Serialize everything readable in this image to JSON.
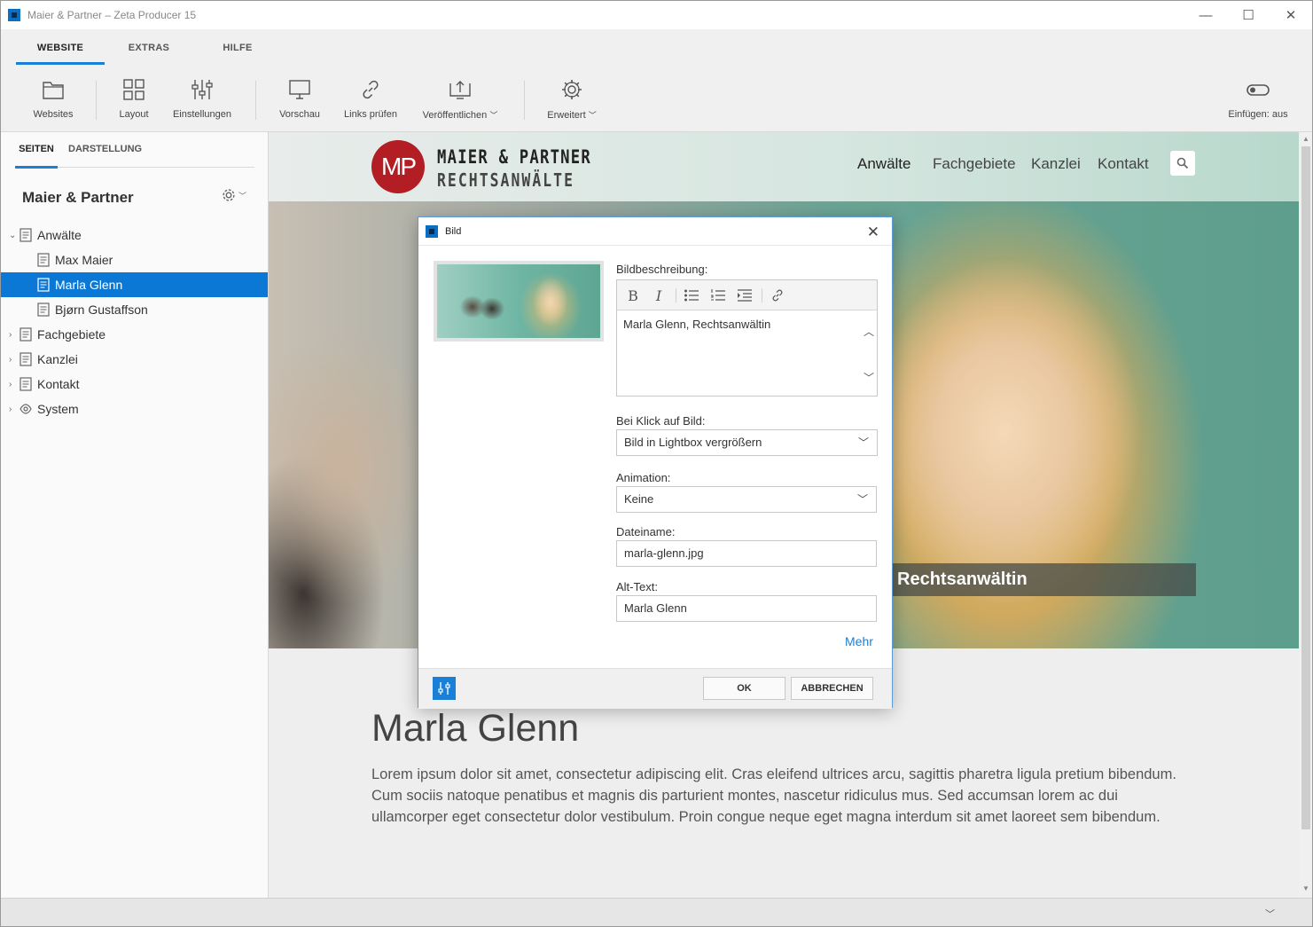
{
  "window": {
    "title": "Maier & Partner – Zeta Producer 15",
    "minimize": "—",
    "maximize": "☐",
    "close": "✕"
  },
  "ribbon": {
    "tabs": [
      "WEBSITE",
      "EXTRAS",
      "HILFE"
    ],
    "active_tab": "WEBSITE",
    "buttons": {
      "websites": "Websites",
      "layout": "Layout",
      "settings": "Einstellungen",
      "preview": "Vorschau",
      "check_links": "Links prüfen",
      "publish": "Veröffentlichen",
      "advanced": "Erweitert",
      "insert": "Einfügen: aus"
    }
  },
  "sidebar": {
    "tabs": [
      "SEITEN",
      "DARSTELLUNG"
    ],
    "site_title": "Maier & Partner",
    "tree": [
      {
        "label": "Anwälte",
        "level": 0,
        "expander": "⌄",
        "icon": "page-icon"
      },
      {
        "label": "Max Maier",
        "level": 1,
        "expander": "",
        "icon": "page-icon"
      },
      {
        "label": "Marla Glenn",
        "level": 1,
        "expander": "",
        "icon": "page-icon",
        "selected": true
      },
      {
        "label": "Bjørn Gustaffson",
        "level": 1,
        "expander": "",
        "icon": "page-icon"
      },
      {
        "label": "Fachgebiete",
        "level": 0,
        "expander": "›",
        "icon": "page-icon"
      },
      {
        "label": "Kanzlei",
        "level": 0,
        "expander": "›",
        "icon": "page-icon"
      },
      {
        "label": "Kontakt",
        "level": 0,
        "expander": "›",
        "icon": "page-icon"
      },
      {
        "label": "System",
        "level": 0,
        "expander": "›",
        "icon": "eye-icon"
      }
    ]
  },
  "site": {
    "logo_mark": "MP",
    "logo_line1": "MAIER & PARTNER",
    "logo_line2": "RECHTSANWÄLTE",
    "nav": [
      "Anwälte",
      "Fachgebiete",
      "Kanzlei",
      "Kontakt"
    ],
    "hero_caption": "Rechtsanwältin",
    "heading": "Marla Glenn",
    "body": "Lorem ipsum dolor sit amet, consectetur adipiscing elit. Cras eleifend ultrices arcu, sagittis pharetra ligula pretium bibendum. Cum sociis natoque penatibus et magnis dis parturient montes, nascetur ridiculus mus. Sed accumsan lorem ac dui ullamcorper eget consectetur dolor vestibulum. Proin congue neque eget magna interdum sit amet laoreet sem bibendum."
  },
  "dialog": {
    "title": "Bild",
    "close": "✕",
    "description_label": "Bildbeschreibung:",
    "description_value": "Marla Glenn, Rechtsanwältin",
    "toolbar": {
      "bold": "B",
      "italic": "I"
    },
    "click_label": "Bei Klick auf Bild:",
    "click_value": "Bild in Lightbox vergrößern",
    "animation_label": "Animation:",
    "animation_value": "Keine",
    "filename_label": "Dateiname:",
    "filename_value": "marla-glenn.jpg",
    "alt_label": "Alt-Text:",
    "alt_value": "Marla Glenn",
    "more": "Mehr",
    "ok": "OK",
    "cancel": "ABBRECHEN"
  },
  "colors": {
    "accent": "#1a7fd6",
    "selection": "#0a78d4",
    "logo_red": "#b21e23"
  }
}
